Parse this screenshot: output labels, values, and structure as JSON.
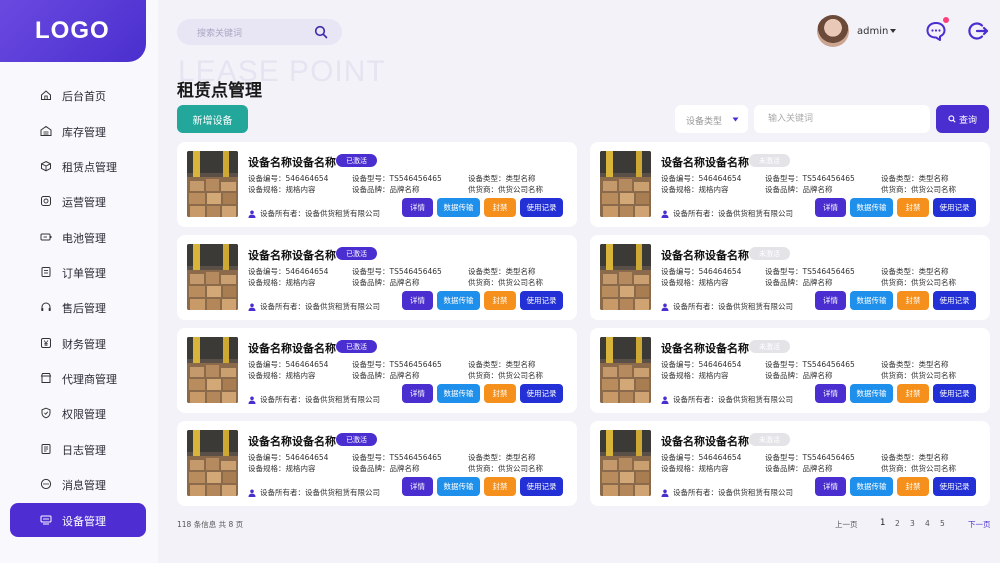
{
  "logo": "LOGO",
  "nav": [
    {
      "label": "后台首页",
      "icon": "home-icon"
    },
    {
      "label": "库存管理",
      "icon": "warehouse-icon"
    },
    {
      "label": "租赁点管理",
      "icon": "box-icon"
    },
    {
      "label": "运营管理",
      "icon": "operations-icon"
    },
    {
      "label": "电池管理",
      "icon": "battery-icon"
    },
    {
      "label": "订单管理",
      "icon": "order-icon"
    },
    {
      "label": "售后管理",
      "icon": "headset-icon"
    },
    {
      "label": "财务管理",
      "icon": "yen-icon"
    },
    {
      "label": "代理商管理",
      "icon": "store-icon"
    },
    {
      "label": "权限管理",
      "icon": "shield-icon"
    },
    {
      "label": "日志管理",
      "icon": "log-icon"
    },
    {
      "label": "消息管理",
      "icon": "chat-icon"
    },
    {
      "label": "设备管理",
      "icon": "device-icon",
      "active": true
    }
  ],
  "header": {
    "search_placeholder": "搜索关键词",
    "username": "admin"
  },
  "page": {
    "bg_title": "LEASE POINT",
    "title": "租赁点管理",
    "add_button": "新增设备",
    "type_select": "设备类型",
    "keyword_placeholder": "输入关键词",
    "query_button": "查询"
  },
  "card_template": {
    "name": "设备名称设备名称",
    "status_active": "已激活",
    "status_inactive": "未激活",
    "code": "设备编号：546464654",
    "model": "设备型号：TS546456465",
    "type": "设备类型：类型名称",
    "spec": "设备规格：规格内容",
    "brand": "设备品牌：品牌名称",
    "supplier": "供货商：供货公司名称",
    "owner": "设备所有者：设备供货租赁有限公司",
    "buttons": [
      "详情",
      "数据传输",
      "封禁",
      "使用记录"
    ]
  },
  "cards": [
    {
      "status": "active"
    },
    {
      "status": "inactive"
    },
    {
      "status": "active"
    },
    {
      "status": "inactive"
    },
    {
      "status": "active"
    },
    {
      "status": "inactive"
    },
    {
      "status": "active"
    },
    {
      "status": "inactive"
    }
  ],
  "footer": {
    "total": "118 条信息 共 8 页",
    "prev": "上一页",
    "pages": [
      "1",
      "2",
      "3",
      "4",
      "5"
    ],
    "current_page": "1",
    "next": "下一页"
  },
  "colors": {
    "primary": "#4b2ecf",
    "teal": "#22a79a",
    "blue": "#1e8fea",
    "orange": "#f5901c",
    "indigo": "#2230d6"
  }
}
